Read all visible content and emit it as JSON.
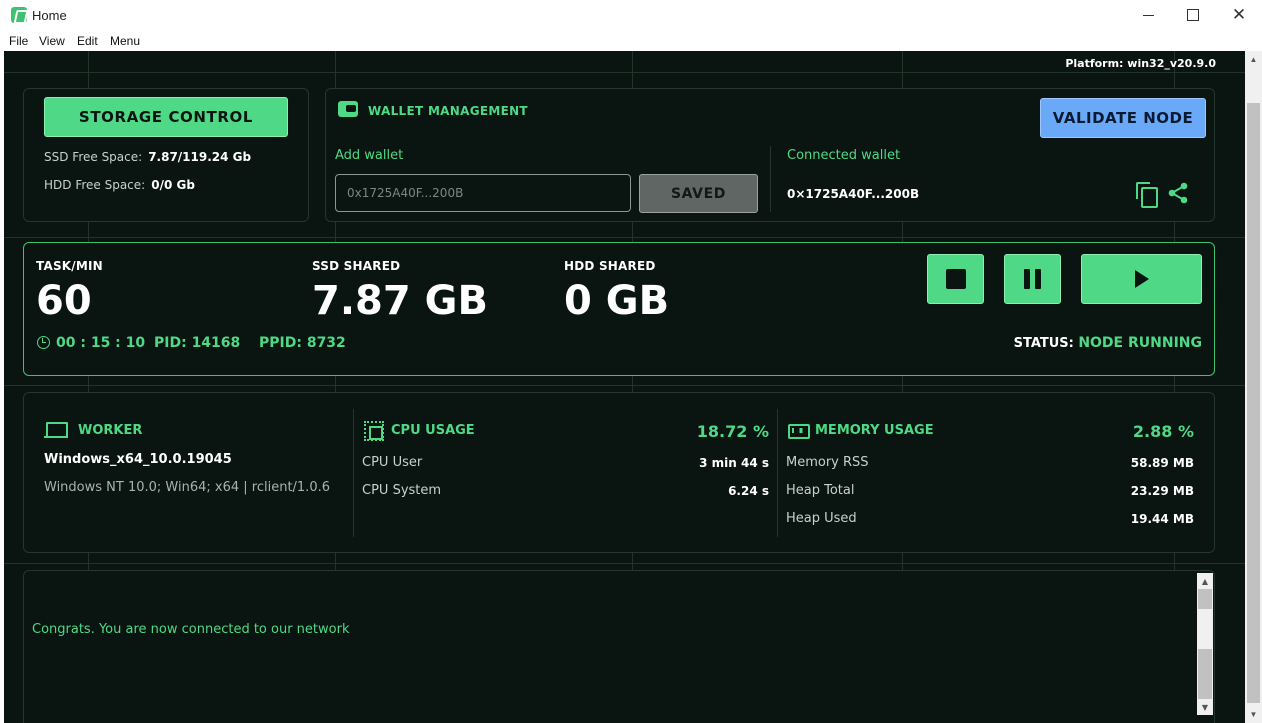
{
  "window": {
    "title": "Home",
    "min_glyph": "",
    "max_glyph": "",
    "close_glyph": "✕"
  },
  "menu": [
    "File",
    "View",
    "Edit",
    "Menu"
  ],
  "platform": "Platform: win32_v20.9.0",
  "storage": {
    "button_label": "STORAGE CONTROL",
    "ssd_label": "SSD Free Space:",
    "ssd_value": "7.87/119.24 Gb",
    "hdd_label": "HDD Free Space:",
    "hdd_value": "0/0 Gb"
  },
  "wallet": {
    "title": "WALLET MANAGEMENT",
    "validate_label": "VALIDATE NODE",
    "add_label": "Add wallet",
    "input_value": "0x1725A40F...200B",
    "saved_label": "SAVED",
    "connected_label": "Connected wallet",
    "connected_value": "0×1725A40F...200B"
  },
  "task": {
    "task_label": "TASK/MIN",
    "task_value": "60",
    "ssd_label": "SSD SHARED",
    "ssd_value": "7.87 GB",
    "hdd_label": "HDD SHARED",
    "hdd_value": "0 GB",
    "timer": "00 : 15 : 10",
    "pid": "PID: 14168",
    "ppid": "PPID: 8732",
    "status_label": "STATUS:",
    "status_value": "NODE RUNNING"
  },
  "worker": {
    "title": "WORKER",
    "os": "Windows_x64_10.0.19045",
    "agent": "Windows NT 10.0; Win64; x64 | rclient/1.0.6"
  },
  "cpu": {
    "title": "CPU USAGE",
    "percent": "18.72 %",
    "rows": [
      {
        "label": "CPU User",
        "value": "3 min 44 s"
      },
      {
        "label": "CPU System",
        "value": "6.24 s"
      }
    ]
  },
  "memory": {
    "title": "MEMORY USAGE",
    "percent": "2.88 %",
    "rows": [
      {
        "label": "Memory RSS",
        "value": "58.89 MB"
      },
      {
        "label": "Heap Total",
        "value": "23.29 MB"
      },
      {
        "label": "Heap Used",
        "value": "19.44 MB"
      }
    ]
  },
  "log": {
    "message": "Congrats. You are now connected to our network"
  },
  "colors": {
    "accent": "#4fd987",
    "validate": "#6aa9f7",
    "background": "#0a1410"
  },
  "icons": [
    "app-icon",
    "wallet-icon",
    "copy-icon",
    "share-icon",
    "clock-icon",
    "stop-icon",
    "pause-icon",
    "play-icon",
    "laptop-icon",
    "cpu-chip-icon",
    "ram-icon"
  ]
}
